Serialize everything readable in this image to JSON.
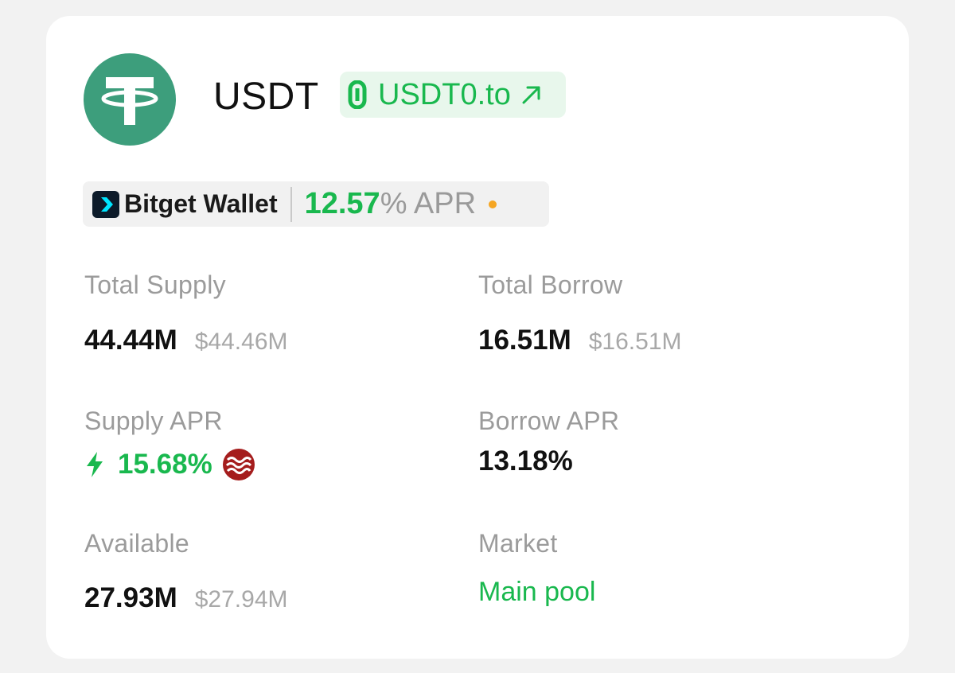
{
  "token": {
    "symbol": "USDT",
    "logo_icon": "tether-icon",
    "link_label": "USDT0.to",
    "link_arrow": "↗"
  },
  "wallet": {
    "name": "Bitget Wallet",
    "apr_value": "12.57",
    "apr_suffix": "% APR",
    "status_color": "#f5a623"
  },
  "stats": {
    "total_supply": {
      "label": "Total Supply",
      "amount": "44.44M",
      "usd": "$44.46M"
    },
    "total_borrow": {
      "label": "Total Borrow",
      "amount": "16.51M",
      "usd": "$16.51M"
    },
    "supply_apr": {
      "label": "Supply APR",
      "value": "15.68%",
      "reward_icon": "sui-icon"
    },
    "borrow_apr": {
      "label": "Borrow APR",
      "value": "13.18%"
    },
    "available": {
      "label": "Available",
      "amount": "27.93M",
      "usd": "$27.94M"
    },
    "market": {
      "label": "Market",
      "value": "Main pool"
    }
  },
  "colors": {
    "accent_green": "#19b84e",
    "tether_green": "#3d9e7c",
    "muted_text": "#9b9b9b"
  }
}
